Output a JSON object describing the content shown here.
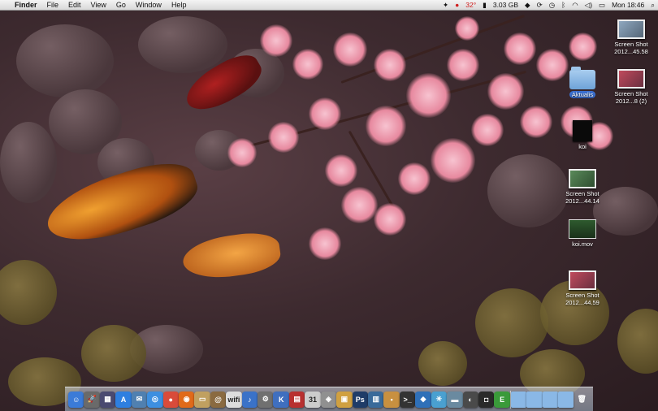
{
  "menubar": {
    "apple_symbol": "",
    "app_name": "Finder",
    "menus": [
      "File",
      "Edit",
      "View",
      "Go",
      "Window",
      "Help"
    ],
    "status": {
      "temperature": "32°",
      "memory": "3.03 GB",
      "clock": "Mon 18:46"
    }
  },
  "desktop_icons": [
    {
      "label": "Screen Shot 2012...45.58",
      "kind": "screenshot"
    },
    {
      "label": "Screen Shot 2012...8 (2)",
      "kind": "screenshot"
    },
    {
      "label": "Aktualis",
      "kind": "folder"
    },
    {
      "label": "koi",
      "kind": "document"
    },
    {
      "label": "Screen Shot 2012...44.14",
      "kind": "screenshot"
    },
    {
      "label": "koi.mov",
      "kind": "movie"
    },
    {
      "label": "Screen Shot 2012...44.59",
      "kind": "screenshot"
    }
  ],
  "dock": {
    "items": [
      {
        "name": "finder",
        "glyph": "☺",
        "color": "#3b7bd8"
      },
      {
        "name": "launchpad",
        "glyph": "🚀",
        "color": "#6a6a6a"
      },
      {
        "name": "mission-control",
        "glyph": "▦",
        "color": "#4a4a70"
      },
      {
        "name": "app-store",
        "glyph": "A",
        "color": "#2e7fe0"
      },
      {
        "name": "mail",
        "glyph": "✉",
        "color": "#5080b0"
      },
      {
        "name": "safari",
        "glyph": "◎",
        "color": "#3d8fe0"
      },
      {
        "name": "chrome",
        "glyph": "●",
        "color": "#d94b3a"
      },
      {
        "name": "firefox",
        "glyph": "◉",
        "color": "#e06a1a"
      },
      {
        "name": "preview",
        "glyph": "▭",
        "color": "#c0a060"
      },
      {
        "name": "contacts",
        "glyph": "@",
        "color": "#8a6a40"
      },
      {
        "name": "wifi-tool",
        "glyph": "wifi",
        "color": "#dddddd"
      },
      {
        "name": "itunes",
        "glyph": "♪",
        "color": "#3a72c8"
      },
      {
        "name": "system-preferences",
        "glyph": "⚙",
        "color": "#707070"
      },
      {
        "name": "keynote",
        "glyph": "K",
        "color": "#3f6fbf"
      },
      {
        "name": "photo-booth",
        "glyph": "▤",
        "color": "#b83030"
      },
      {
        "name": "calendar",
        "glyph": "31",
        "color": "#cccccc"
      },
      {
        "name": "photo-app",
        "glyph": "◈",
        "color": "#909090"
      },
      {
        "name": "folder-app",
        "glyph": "▣",
        "color": "#d0a040"
      },
      {
        "name": "photoshop",
        "glyph": "Ps",
        "color": "#1f3c68"
      },
      {
        "name": "virtual-machine",
        "glyph": "▥",
        "color": "#3a6a9a"
      },
      {
        "name": "archive",
        "glyph": "▪",
        "color": "#c89040"
      },
      {
        "name": "terminal",
        "glyph": ">_",
        "color": "#333333"
      },
      {
        "name": "dropbox",
        "glyph": "◆",
        "color": "#2f70b8"
      },
      {
        "name": "snowflake-app",
        "glyph": "✳",
        "color": "#4aa0d0"
      },
      {
        "name": "trash-app",
        "glyph": "▬",
        "color": "#6a8aa0"
      },
      {
        "name": "screen-recorder",
        "glyph": "◐",
        "color": "#4a4a4a"
      },
      {
        "name": "camera",
        "glyph": "◘",
        "color": "#2a2a2a"
      },
      {
        "name": "evernote",
        "glyph": "E",
        "color": "#3a9a3a"
      }
    ],
    "folders": [
      {
        "name": "applications-stack",
        "color": "#8ab8e6"
      },
      {
        "name": "documents-stack",
        "color": "#8ab8e6"
      },
      {
        "name": "downloads-stack",
        "color": "#8ab8e6"
      },
      {
        "name": "stack-4",
        "color": "#8ab8e6"
      }
    ],
    "trash": {
      "name": "trash",
      "glyph": "🗑"
    }
  }
}
